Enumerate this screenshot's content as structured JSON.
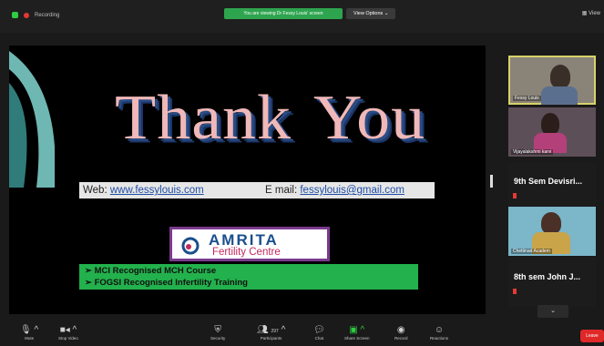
{
  "topbar": {
    "recording_label": "Recording",
    "viewing_label": "You are viewing Dr Fessy Louis' screen",
    "view_options_label": "View Options ⌄",
    "view_label": "View"
  },
  "slide": {
    "thank": "Thank",
    "you": "You",
    "web_label": "Web:",
    "web_url": "www.fessylouis.com",
    "email_label": "E mail:",
    "email_value": "fessylouis@gmail.com",
    "amrita_title": "AMRITA",
    "amrita_sub": "Fertility Centre",
    "line1": "➢  MCI Recognised MCH Course",
    "line2": "➢  FOGSI Recognised Infertility Training"
  },
  "participants": [
    {
      "name": "Fessy Louis"
    },
    {
      "name": "Vijayalakshmi karvi"
    },
    {
      "name": "9th Sem Devisri..."
    },
    {
      "name": "Chettinad Academ"
    },
    {
      "name": "8th sem John J..."
    }
  ],
  "toolbar": {
    "mute": "Mute",
    "stop_video": "Stop Video",
    "security": "Security",
    "participants": "Participants",
    "participants_count": "297",
    "chat": "Chat",
    "share_screen": "Share Screen",
    "record": "Record",
    "reactions": "Reactions",
    "leave": "Leave"
  },
  "colors": {
    "accent_green": "#2ea44f",
    "leave_red": "#e02828",
    "highlight": "#d8d26a"
  }
}
